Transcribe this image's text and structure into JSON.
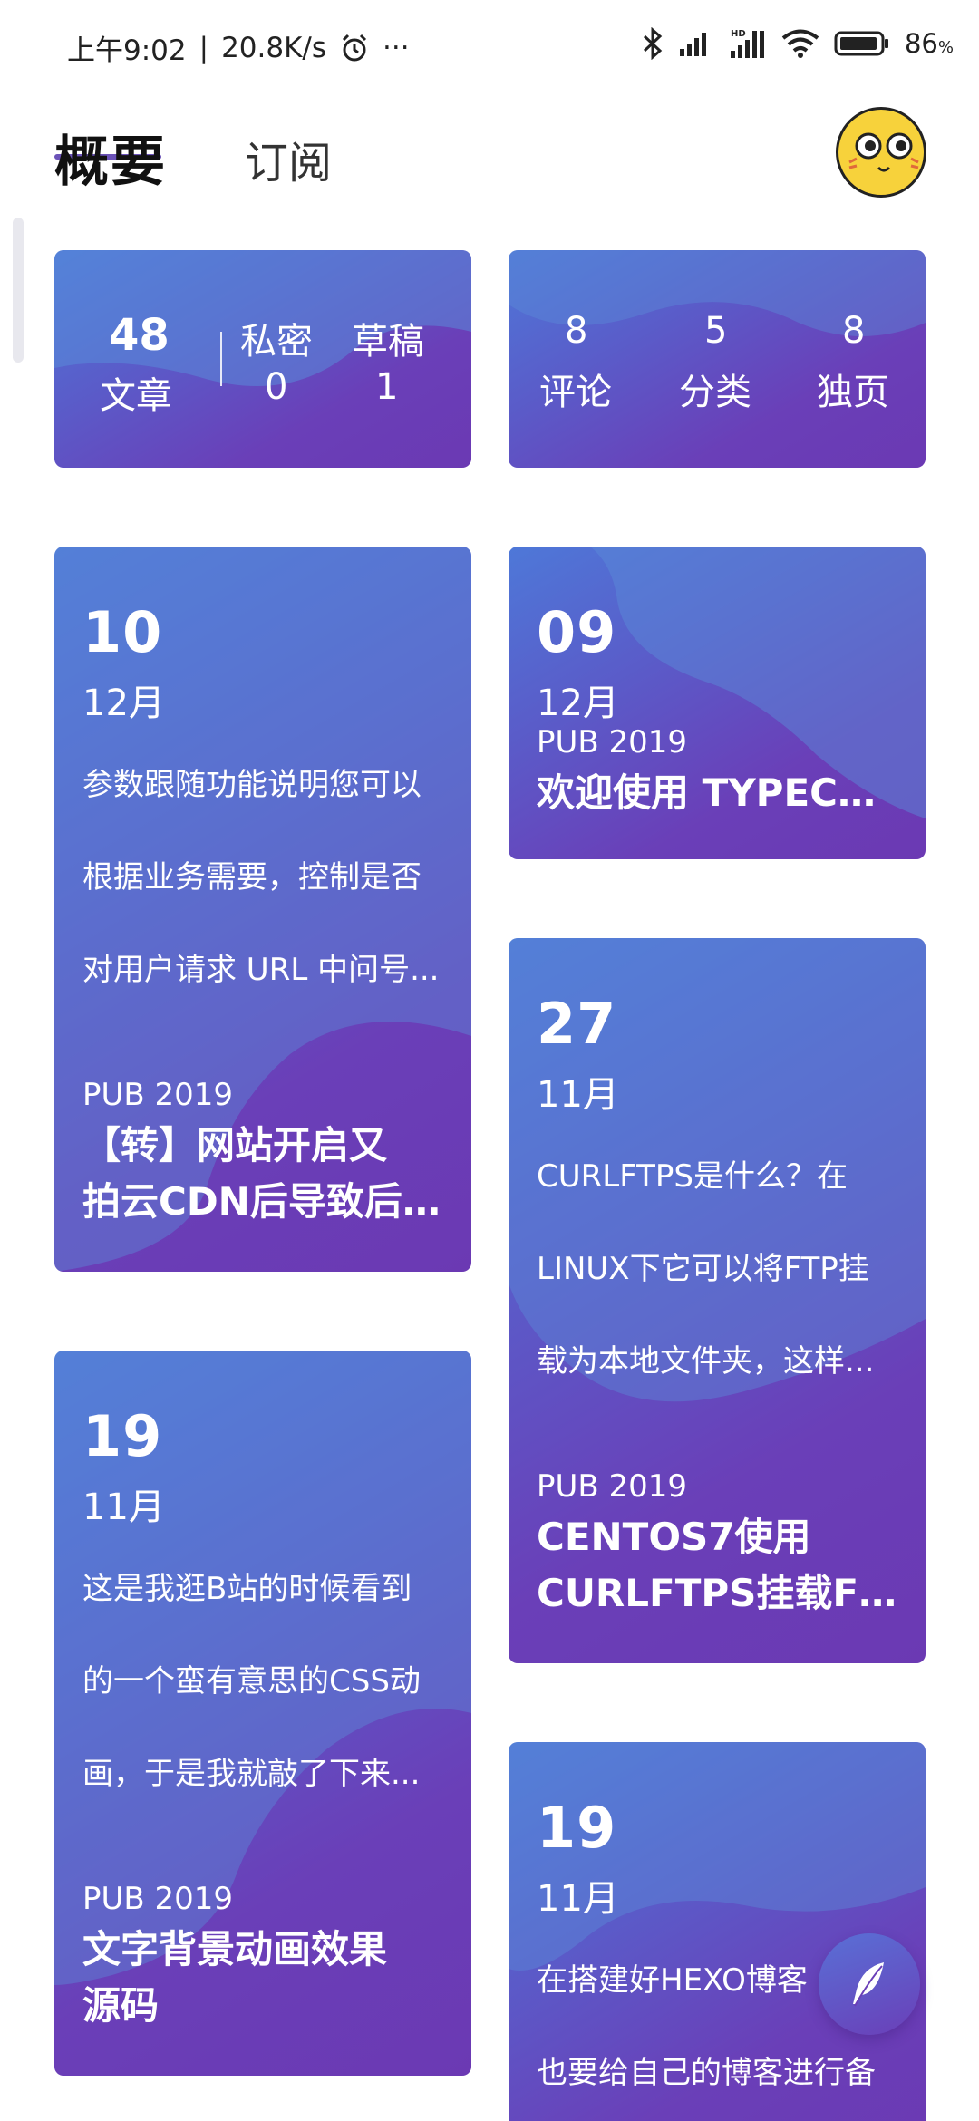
{
  "status_bar": {
    "time": "上午9:02",
    "speed": "20.8K/s",
    "more": "···",
    "battery": "86",
    "battery_unit": "%"
  },
  "header": {
    "tabs": [
      {
        "label": "概要",
        "active": true
      },
      {
        "label": "订阅",
        "active": false
      }
    ]
  },
  "stats": {
    "articles": {
      "value": "48",
      "label": "文章"
    },
    "private": {
      "label": "私密",
      "value": "0"
    },
    "drafts": {
      "label": "草稿",
      "value": "1"
    },
    "comments": {
      "value": "8",
      "label": "评论"
    },
    "categories": {
      "value": "5",
      "label": "分类"
    },
    "pages": {
      "value": "8",
      "label": "独页"
    }
  },
  "posts": [
    {
      "day": "10",
      "month": "12月",
      "excerpt_lines": [
        "参数跟随功能说明您可以",
        "根据业务需要，控制是否",
        "对用户请求 URL 中问号..."
      ],
      "pub": "PUB 2019",
      "title_lines": [
        "【转】网站开启又",
        "拍云CDN后导致后..."
      ]
    },
    {
      "day": "09",
      "month": "12月",
      "excerpt_lines": [],
      "pub": "PUB 2019",
      "title_lines": [
        "欢迎使用 TYPECHO"
      ]
    },
    {
      "day": "27",
      "month": "11月",
      "excerpt_lines": [
        "CURLFTPS是什么？在",
        "LINUX下它可以将FTP挂",
        "载为本地文件夹，这样..."
      ],
      "pub": "PUB 2019",
      "title_lines": [
        "CENTOS7使用",
        "CURLFTPS挂载FT..."
      ]
    },
    {
      "day": "19",
      "month": "11月",
      "excerpt_lines": [
        "这是我逛B站的时候看到",
        "的一个蛮有意思的CSS动",
        "画，于是我就敲了下来..."
      ],
      "pub": "PUB 2019",
      "title_lines": [
        "文字背景动画效果",
        "源码"
      ]
    },
    {
      "day": "19",
      "month": "11月",
      "excerpt_lines": [
        "在搭建好HEXO博客",
        "也要给自己的博客进行备"
      ],
      "pub": "",
      "title_lines": []
    }
  ],
  "fab": {
    "icon": "feather-icon"
  },
  "colors": {
    "card_top": "#4e78d8",
    "card_bottom": "#6b39b3",
    "blob": "#5d4cc4"
  }
}
